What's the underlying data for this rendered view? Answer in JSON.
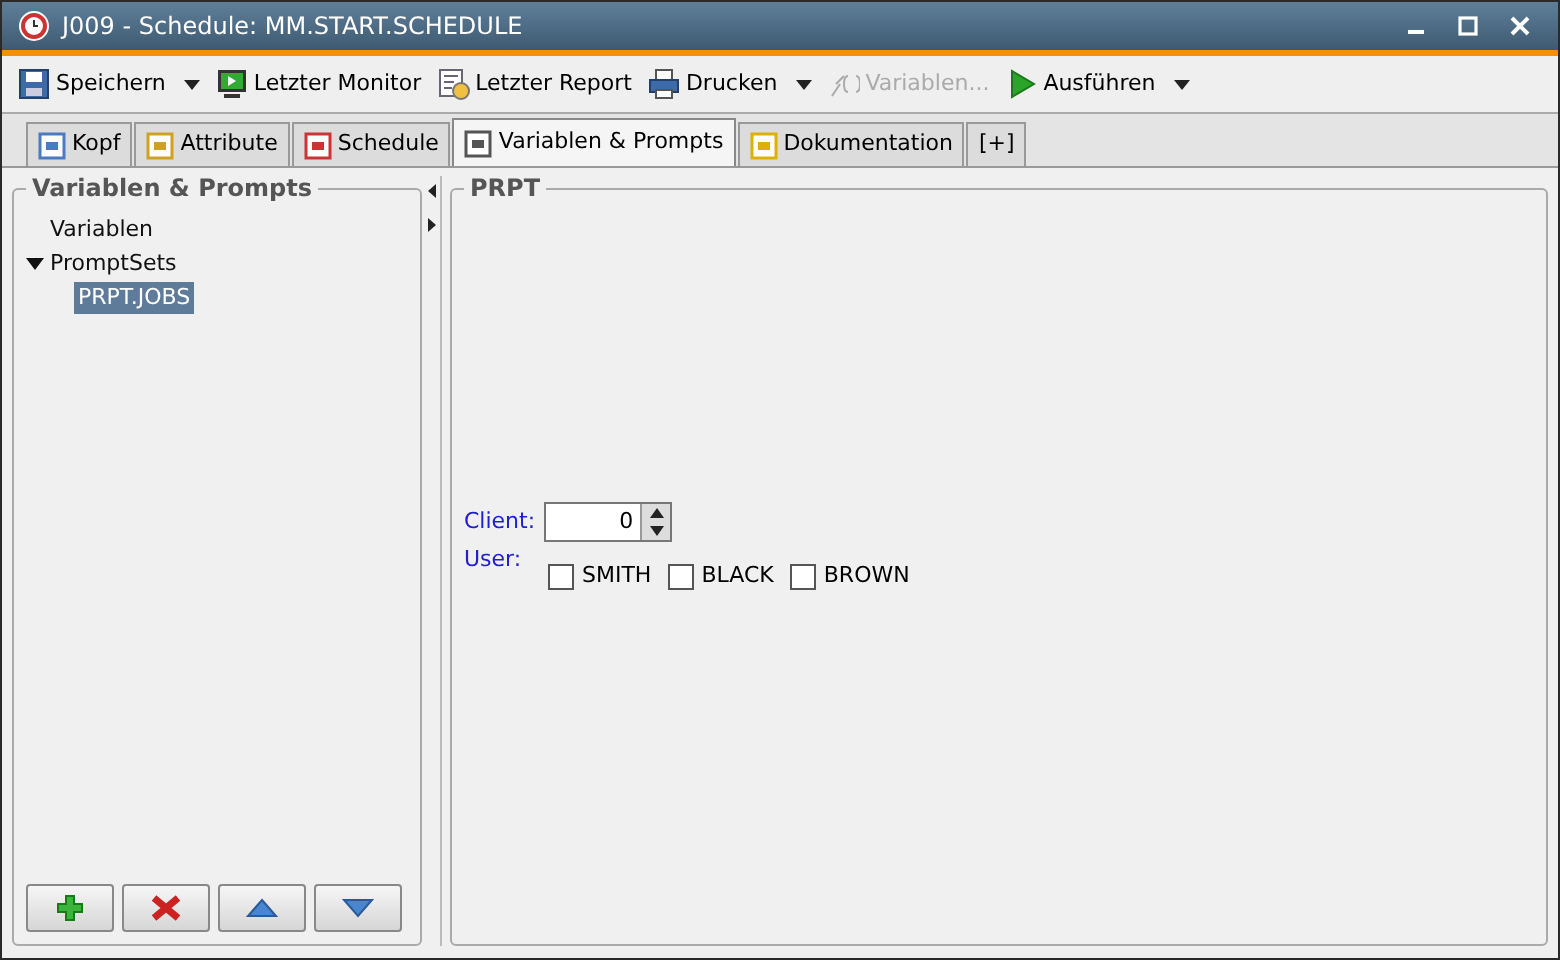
{
  "window": {
    "title": "J009 - Schedule: MM.START.SCHEDULE"
  },
  "toolbar": [
    {
      "label": "Speichern",
      "dropdown": true,
      "disabled": false
    },
    {
      "label": "Letzter Monitor",
      "dropdown": false,
      "disabled": false
    },
    {
      "label": "Letzter Report",
      "dropdown": false,
      "disabled": false
    },
    {
      "label": "Drucken",
      "dropdown": true,
      "disabled": false
    },
    {
      "label": "Variablen...",
      "dropdown": false,
      "disabled": true
    },
    {
      "label": "Ausführen",
      "dropdown": true,
      "disabled": false
    }
  ],
  "tabs": [
    {
      "label": "Kopf",
      "selected": false
    },
    {
      "label": "Attribute",
      "selected": false
    },
    {
      "label": "Schedule",
      "selected": false
    },
    {
      "label": "Variablen & Prompts",
      "selected": true
    },
    {
      "label": "Dokumentation",
      "selected": false
    },
    {
      "label": "[+]",
      "selected": false
    }
  ],
  "left_panel": {
    "title": "Variablen & Prompts",
    "tree": [
      {
        "label": "Variablen",
        "selected": false
      },
      {
        "label": "PromptSets",
        "selected": false,
        "expanded": true,
        "children": [
          {
            "label": "PRPT.JOBS",
            "selected": true
          }
        ]
      }
    ]
  },
  "right_panel": {
    "title": "PRPT",
    "client": {
      "label": "Client:",
      "value": "0"
    },
    "user": {
      "label": "User:",
      "options": [
        {
          "label": "SMITH",
          "checked": false
        },
        {
          "label": "BLACK",
          "checked": false
        },
        {
          "label": "BROWN",
          "checked": false
        }
      ]
    }
  }
}
